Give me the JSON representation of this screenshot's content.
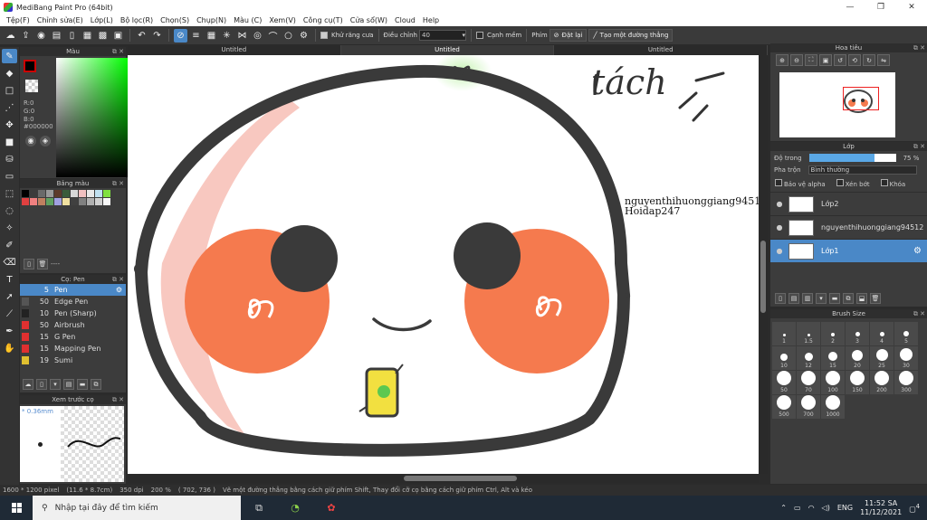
{
  "window": {
    "title": "MediBang Paint Pro (64bit)",
    "minimize": "—",
    "restore": "❐",
    "close": "✕"
  },
  "menu": [
    "Tệp(F)",
    "Chỉnh sửa(E)",
    "Lớp(L)",
    "Bộ lọc(R)",
    "Chọn(S)",
    "Chụp(N)",
    "Màu (C)",
    "Xem(V)",
    "Công cụ(T)",
    "Cửa sổ(W)",
    "Cloud",
    "Help"
  ],
  "toolbar": {
    "antialias_label": "Khử răng cưa",
    "correction_label": "Điều chỉnh",
    "correction_value": "40",
    "edge_label": "Cạnh mềm",
    "key_label": "Phím",
    "reset_label": "Đặt lại",
    "straight_line_label": "Tạo một đường thẳng"
  },
  "doc_tabs": [
    "Untitled",
    "Untitled",
    "Untitled"
  ],
  "color_panel": {
    "title": "Màu",
    "r": "R:0",
    "g": "G:0",
    "b": "B:0",
    "hex": "#000000"
  },
  "palette_panel": {
    "title": "Bảng màu",
    "dash": "----",
    "colors": [
      "#000000",
      "#3b3b3b",
      "#6a6a6a",
      "#9a9a9a",
      "#5c3a2a",
      "#3a5c3a",
      "#d8d8d8",
      "#f0c0c0",
      "#e8e8e8",
      "#c0e0f0",
      "#80e040",
      "#e04040",
      "#f08080",
      "#c08060",
      "#60a060",
      "#a0a0e0",
      "#f0e0a0",
      "#404040",
      "#808080",
      "#b0b0b0",
      "#d0d0d0",
      "#f8f8f8"
    ]
  },
  "brush_panel": {
    "title": "Cọ: Pen",
    "brushes": [
      {
        "size": "5",
        "name": "Pen",
        "color": "#4a88c7"
      },
      {
        "size": "50",
        "name": "Edge Pen",
        "color": "#555555"
      },
      {
        "size": "10",
        "name": "Pen (Sharp)",
        "color": "#222222"
      },
      {
        "size": "50",
        "name": "Airbrush",
        "color": "#e03030"
      },
      {
        "size": "15",
        "name": "G Pen",
        "color": "#e03030"
      },
      {
        "size": "15",
        "name": "Mapping Pen",
        "color": "#e03030"
      },
      {
        "size": "19",
        "name": "Sumi",
        "color": "#e0c030"
      }
    ]
  },
  "preview_panel": {
    "title": "Xem trước cọ",
    "size_mm": "* 0.36mm"
  },
  "canvas": {
    "handwriting": "tách",
    "watermark_name": "nguyenthihuonggiang94512",
    "watermark_site": "Hoidap247"
  },
  "navigator": {
    "title": "Hoa tiêu"
  },
  "layers": {
    "title": "Lớp",
    "opacity_label": "Độ trong",
    "opacity_value": 75,
    "opacity_text": "75 %",
    "blend_label": "Pha trộn",
    "blend_value": "Bình thường",
    "protect_alpha": "Bảo vệ alpha",
    "clipping": "Xén bớt",
    "lock": "Khóa",
    "items": [
      {
        "name": "Lớp2",
        "selected": false
      },
      {
        "name": "nguyenthihuonggiang94512",
        "selected": false
      },
      {
        "name": "Lớp1",
        "selected": true
      }
    ]
  },
  "brush_size": {
    "title": "Brush Size",
    "sizes": [
      "1",
      "1.5",
      "2",
      "3",
      "4",
      "5",
      "10",
      "12",
      "15",
      "20",
      "25",
      "30",
      "50",
      "70",
      "100",
      "150",
      "200",
      "300",
      "500",
      "700",
      "1000"
    ]
  },
  "status": {
    "dimensions": "1600 * 1200 pixel",
    "physical": "(11.6 * 8.7cm)",
    "dpi": "350 dpi",
    "zoom": "200 %",
    "cursor": "( 702, 736 )",
    "hint": "Vẽ một đường thẳng bằng cách giữ phím Shift, Thay đổi cỡ cọ bằng cách giữ phím Ctrl, Alt và kéo"
  },
  "taskbar": {
    "search_placeholder": "Nhập tại đây để tìm kiếm",
    "lang": "ENG",
    "time": "11:52 SA",
    "date": "11/12/2021",
    "notifications": "4"
  }
}
